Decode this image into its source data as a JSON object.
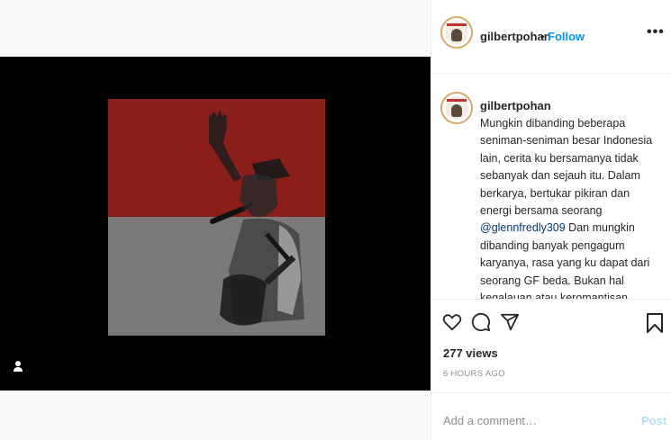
{
  "post": {
    "username": "gilbertpohan",
    "separator": "•",
    "follow_label": "Follow",
    "more_label": "•••"
  },
  "caption": {
    "username": "gilbertpohan",
    "text_before": "Mungkin dibanding beberapa seniman-seniman besar Indonesia lain, cerita ku bersamanya tidak sebanyak dan sejauh itu. Dalam berkarya, bertukar pikiran dan energi bersama seorang ",
    "mention": "@glennfredly309",
    "text_after": " Dan mungkin dibanding banyak pengagum karyanya, rasa yang ku dapat dari seorang GF beda. Bukan hal kegalauan atau keromantisan"
  },
  "stats": {
    "views": "277 views",
    "time": "6 HOURS AGO"
  },
  "comment_box": {
    "placeholder": "Add a comment…",
    "post_label": "Post"
  },
  "icons": [
    "user-tag-icon",
    "heart-icon",
    "comment-icon",
    "share-icon",
    "bookmark-icon"
  ],
  "colors": {
    "follow": "#0095f6",
    "post_disabled": "#b2dffc",
    "mention": "#00376b",
    "flag_red": "#8a1f1a",
    "flag_grey": "#7a7a7a"
  }
}
